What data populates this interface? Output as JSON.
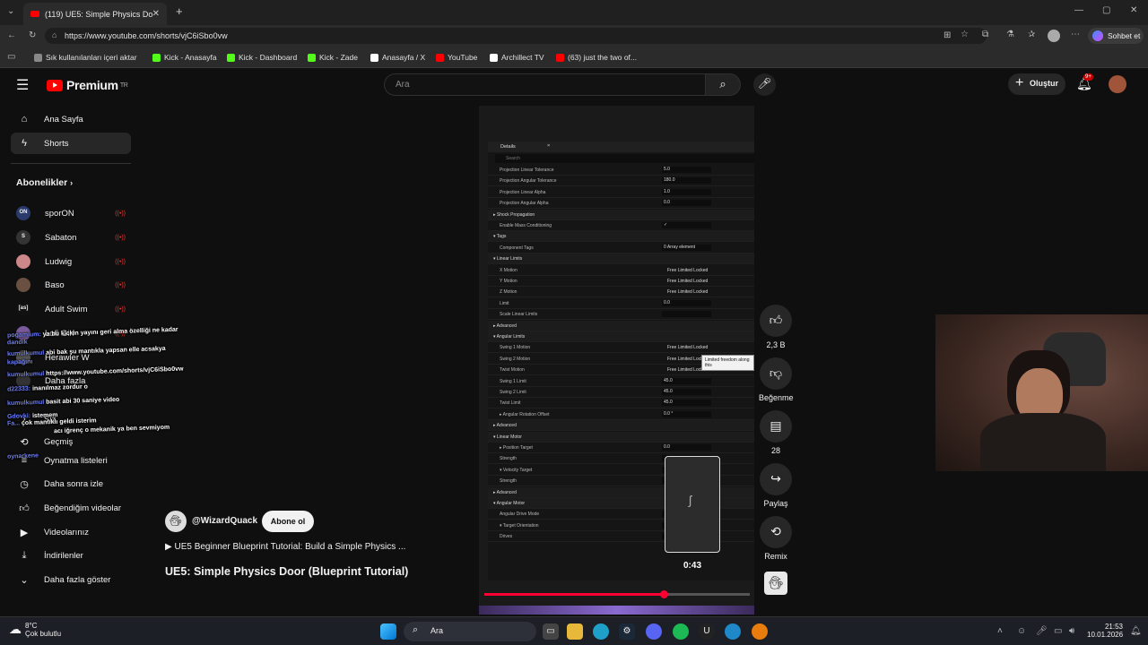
{
  "browser": {
    "tab_title": "(119) UE5: Simple Physics Door (Bl",
    "url": "https://www.youtube.com/shorts/vjC6iSbo0vw",
    "chat_button": "Sohbet et",
    "bookmarks": [
      {
        "label": "Sık kullanılanları içeri aktar",
        "color": "#888888"
      },
      {
        "label": "Kick - Anasayfa",
        "color": "#53fc18"
      },
      {
        "label": "Kick - Dashboard",
        "color": "#53fc18"
      },
      {
        "label": "Kick - Zade",
        "color": "#53fc18"
      },
      {
        "label": "Anasayfa / X",
        "color": "#ffffff"
      },
      {
        "label": "YouTube",
        "color": "#ff0000"
      },
      {
        "label": "Archillect TV",
        "color": "#ffffff"
      },
      {
        "label": "(63) just the two of...",
        "color": "#ff0000"
      }
    ]
  },
  "youtube": {
    "logo": "Premium",
    "logo_region": "TR",
    "search_placeholder": "Ara",
    "create_label": "Oluştur",
    "notif_badge": "9+",
    "nav": [
      {
        "label": "Ana Sayfa",
        "icon": "home-icon"
      },
      {
        "label": "Shorts",
        "icon": "shorts-icon"
      }
    ],
    "subscriptions_title": "Abonelikler",
    "subscriptions": [
      {
        "label": "sporON",
        "avatar": "ON",
        "color": "#2a3a6a",
        "live": true
      },
      {
        "label": "Sabaton",
        "avatar": "S",
        "color": "#333333",
        "live": true
      },
      {
        "label": "Ludwig",
        "avatar": "",
        "color": "#c88",
        "live": true
      },
      {
        "label": "Baso",
        "avatar": "",
        "color": "#6a5040",
        "live": true
      },
      {
        "label": "Adult Swim",
        "avatar": "[as]",
        "color": "#111111",
        "live": true
      },
      {
        "label": "Lofi Girl",
        "avatar": "",
        "color": "#7a5a9a",
        "live": true
      },
      {
        "label": "Herawler W",
        "avatar": "",
        "color": "#555",
        "live": false
      },
      {
        "label": "Daha fazla",
        "avatar": "",
        "color": "#333",
        "live": false
      }
    ],
    "you_section": [
      {
        "label": "Siz",
        "icon": "chevron-right-icon"
      },
      {
        "label": "Geçmiş",
        "icon": "history-icon"
      },
      {
        "label": "Oynatma listeleri",
        "icon": "playlist-icon"
      },
      {
        "label": "Daha sonra izle",
        "icon": "clock-icon"
      },
      {
        "label": "Beğendiğim videolar",
        "icon": "like-icon"
      },
      {
        "label": "Videolarınız",
        "icon": "video-icon"
      },
      {
        "label": "İndirilenler",
        "icon": "download-icon"
      },
      {
        "label": "Daha fazla göster",
        "icon": "chevron-down-icon"
      }
    ],
    "short": {
      "channel": "@WizardQuack",
      "subscribe": "Abone ol",
      "playlist": "▶ UE5 Beginner Blueprint Tutorial: Build a Simple Physics ...",
      "title": "UE5: Simple Physics Door (Blueprint Tutorial)",
      "time": "0:43",
      "progress": 0.675,
      "likes": "2,3 B",
      "dislike": "Beğenme",
      "comments": "28",
      "share": "Paylaş",
      "remix": "Remix"
    },
    "ue_panel": {
      "tab": "Details",
      "search": "Search",
      "rows": [
        {
          "k": "Projection Linear Tolerance",
          "v": "5.0"
        },
        {
          "k": "Projection Angular Tolerance",
          "v": "180.0"
        },
        {
          "k": "Projection Linear Alpha",
          "v": "1.0"
        },
        {
          "k": "Projection Angular Alpha",
          "v": "0.0"
        },
        {
          "k": "▸ Shock Propagation",
          "sec": true
        },
        {
          "k": "Enable Mass Conditioning",
          "v": "✓"
        },
        {
          "k": "▾ Tags",
          "sec": true
        },
        {
          "k": "Component Tags",
          "v": "0 Array element"
        },
        {
          "k": "▾ Linear Limits",
          "sec": true
        },
        {
          "k": "X Motion",
          "o": "Free  Limited  Locked"
        },
        {
          "k": "Y Motion",
          "o": "Free  Limited  Locked"
        },
        {
          "k": "Z Motion",
          "o": "Free  Limited  Locked"
        },
        {
          "k": "Limit",
          "v": "0.0"
        },
        {
          "k": "Scale Linear Limits",
          "v": ""
        },
        {
          "k": "▸ Advanced",
          "sec": true
        },
        {
          "k": "▾ Angular Limits",
          "sec": true
        },
        {
          "k": "Swing 1 Motion",
          "o": "Free  Limited  Locked"
        },
        {
          "k": "Swing 2 Motion",
          "o": "Free  Limited  Locked"
        },
        {
          "k": "Twist Motion",
          "o": "Free  Limited  Locked"
        },
        {
          "k": "Swing 1 Limit",
          "v": "45.0"
        },
        {
          "k": "Swing 2 Limit",
          "v": "45.0"
        },
        {
          "k": "Twist Limit",
          "v": "45.0"
        },
        {
          "k": "▸ Angular Rotation Offset",
          "v": "0.0 °"
        },
        {
          "k": "▸ Advanced",
          "sec": true
        },
        {
          "k": "▾ Linear Motor",
          "sec": true
        },
        {
          "k": "▸ Position Target",
          "v": "0.0"
        },
        {
          "k": "Strength",
          "v": ""
        },
        {
          "k": "▾ Velocity Target",
          "v": ""
        },
        {
          "k": "Strength",
          "v": ""
        },
        {
          "k": "▸ Advanced",
          "sec": true
        },
        {
          "k": "▾ Angular Motor",
          "sec": true
        },
        {
          "k": "Angular Drive Mode",
          "v": ""
        },
        {
          "k": "▾ Target Orientation",
          "v": ""
        },
        {
          "k": "Drives",
          "v": ""
        }
      ],
      "tooltip": "Limited freedom along this"
    }
  },
  "chat_overlay": [
    {
      "user": "pogamium:",
      "msg": "ya bu kickin yayını geri alma özelliği ne kadar"
    },
    {
      "user": "dandik",
      "msg": ""
    },
    {
      "user": "kumulkumul",
      "msg": "abi bak şu mantıkla yapsan elle acsakya"
    },
    {
      "user": "kapağını",
      "msg": ""
    },
    {
      "user": "kumulkumul",
      "msg": "https://www.youtube.com/shorts/vjC6iSbo0vw"
    },
    {
      "user": "d22333:",
      "msg": "inanılmaz zordur o"
    },
    {
      "user": "kumulkumul",
      "msg": "basit abi 30 saniye video"
    },
    {
      "user": "Gdovki:",
      "msg": "istemem"
    },
    {
      "user": "Fa...",
      "msg": "çok mantıklı geldi isterim"
    },
    {
      "user": "",
      "msg": "acı iğrenç o mekanik ya ben sevmiyom"
    },
    {
      "user": "oynarkene",
      "msg": ""
    }
  ],
  "taskbar": {
    "weather_temp": "8°C",
    "weather_desc": "Çok bulutlu",
    "search": "Ara",
    "time": "21:53",
    "date": "10.01.2026"
  }
}
